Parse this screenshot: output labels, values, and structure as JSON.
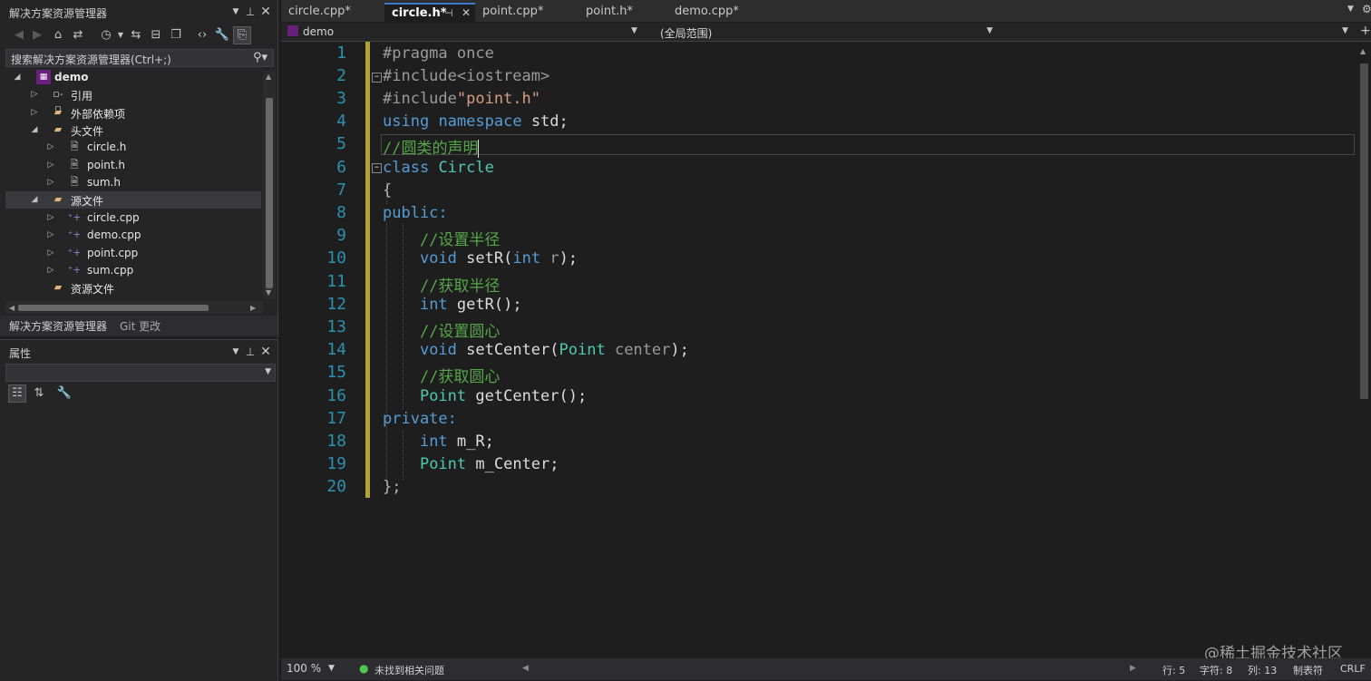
{
  "solution_explorer": {
    "title": "解决方案资源管理器",
    "search_placeholder": "搜索解决方案资源管理器(Ctrl+;)",
    "tree": [
      {
        "label": "demo",
        "icon": "project-icon"
      },
      {
        "label": "引用",
        "icon": "references-icon"
      },
      {
        "label": "外部依赖项",
        "icon": "folder-icon"
      },
      {
        "label": "头文件",
        "icon": "folder-icon"
      },
      {
        "label": "circle.h",
        "icon": "header-file-icon"
      },
      {
        "label": "point.h",
        "icon": "header-file-icon"
      },
      {
        "label": "sum.h",
        "icon": "header-file-icon"
      },
      {
        "label": "源文件",
        "icon": "folder-icon"
      },
      {
        "label": "circle.cpp",
        "icon": "cpp-file-icon"
      },
      {
        "label": "demo.cpp",
        "icon": "cpp-file-icon"
      },
      {
        "label": "point.cpp",
        "icon": "cpp-file-icon"
      },
      {
        "label": "sum.cpp",
        "icon": "cpp-file-icon"
      },
      {
        "label": "资源文件",
        "icon": "folder-icon"
      }
    ],
    "bottom_tabs": [
      "解决方案资源管理器",
      "Git 更改"
    ]
  },
  "properties": {
    "title": "属性"
  },
  "editor": {
    "tabs": [
      "circle.cpp*",
      "circle.h*",
      "point.cpp*",
      "point.h*",
      "demo.cpp*"
    ],
    "active_tab": "circle.h*",
    "nav_project": "demo",
    "nav_scope": "(全局范围)",
    "line_numbers": [
      "1",
      "2",
      "3",
      "4",
      "5",
      "6",
      "7",
      "8",
      "9",
      "10",
      "11",
      "12",
      "13",
      "14",
      "15",
      "16",
      "17",
      "18",
      "19",
      "20"
    ],
    "code": {
      "l1": "#pragma once",
      "l2": "#include<iostream>",
      "l3a": "#include",
      "l3b": "\"point.h\"",
      "l4a": "using",
      "l4b": "namespace",
      "l4c": "std;",
      "l5": "//圆类的声明",
      "l6a": "class",
      "l6b": "Circle",
      "l7": "{",
      "l8": "public:",
      "l9": "//设置半径",
      "l10a": "void",
      "l10b": "setR(",
      "l10c": "int",
      "l10d": "r",
      "l10e": ");",
      "l11": "//获取半径",
      "l12a": "int",
      "l12b": "getR();",
      "l13": "//设置圆心",
      "l14a": "void",
      "l14b": "setCenter(",
      "l14c": "Point",
      "l14d": "center",
      "l14e": ");",
      "l15": "//获取圆心",
      "l16a": "Point",
      "l16b": "getCenter();",
      "l17": "private:",
      "l18a": "int",
      "l18b": "m_R;",
      "l19a": "Point",
      "l19b": "m_Center;",
      "l20": "};"
    }
  },
  "status_bar": {
    "zoom": "100 %",
    "issues": "未找到相关问题",
    "line": "行: 5",
    "char": "字符: 8",
    "col": "列: 13",
    "tabs": "制表符",
    "eol": "CRLF"
  },
  "watermark": "@稀土掘金技术社区",
  "colors": {
    "background": "#1e1e1e",
    "line_number": "#2b91af",
    "keyword": "#569cd6",
    "type": "#4ec9b0",
    "comment": "#57a64a",
    "string": "#d69d85",
    "change_bar": "#b1a13a"
  }
}
